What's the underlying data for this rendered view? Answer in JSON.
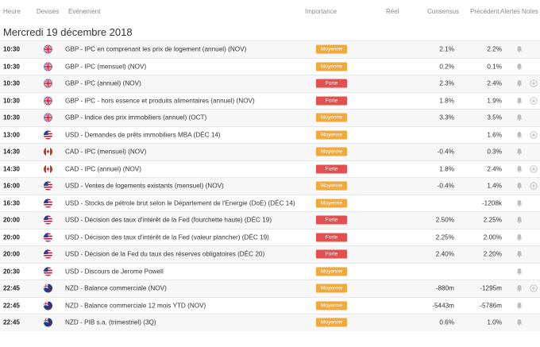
{
  "header": {
    "heure": "Heure",
    "devises": "Devises",
    "evenement": "Evénement",
    "importance": "Importance",
    "reel": "Réel",
    "consensus": "Consensus",
    "precedent": "Précédent",
    "alertes": "Alertes",
    "notes": "Notes"
  },
  "date_title": "Mercredi 19 décembre 2018",
  "colors": {
    "moyenne": "#f0a93b",
    "forte": "#e3504f"
  },
  "rows": [
    {
      "time": "10:30",
      "flag": "gb-flag-icon",
      "event": "GBP - IPC en comprenant les prix de logement (annuel) (NOV)",
      "importance": "Moyenne",
      "level": "moyenne",
      "consensus": "2.1%",
      "previous": "2.2%",
      "plus": false
    },
    {
      "time": "10:30",
      "flag": "gb-flag-icon",
      "event": "GBP - IPC (mensuel) (NOV)",
      "importance": "Moyenne",
      "level": "moyenne",
      "consensus": "0.2%",
      "previous": "0.1%",
      "plus": false
    },
    {
      "time": "10:30",
      "flag": "gb-flag-icon",
      "event": "GBP - IPC (annuel) (NOV)",
      "importance": "Forte",
      "level": "forte",
      "consensus": "2.3%",
      "previous": "2.4%",
      "plus": true
    },
    {
      "time": "10:30",
      "flag": "gb-flag-icon",
      "event": "GBP - IPC - hors essence et produits alimentaires (annuel) (NOV)",
      "importance": "Forte",
      "level": "forte",
      "consensus": "1.8%",
      "previous": "1.9%",
      "plus": true
    },
    {
      "time": "10:30",
      "flag": "gb-flag-icon",
      "event": "GBP - Indice des prix immobiliers (annuel) (OCT)",
      "importance": "Moyenne",
      "level": "moyenne",
      "consensus": "3.3%",
      "previous": "3.5%",
      "plus": false
    },
    {
      "time": "13:00",
      "flag": "us-flag-icon",
      "event": "USD - Demandes de prêts immobiliers MBA (DÉC 14)",
      "importance": "Moyenne",
      "level": "moyenne",
      "consensus": "",
      "previous": "1.6%",
      "plus": true
    },
    {
      "time": "14:30",
      "flag": "ca-flag-icon",
      "event": "CAD - IPC (mensuel) (NOV)",
      "importance": "Moyenne",
      "level": "moyenne",
      "consensus": "-0.4%",
      "previous": "0.3%",
      "plus": false
    },
    {
      "time": "14:30",
      "flag": "ca-flag-icon",
      "event": "CAD - IPC (annuel) (NOV)",
      "importance": "Forte",
      "level": "forte",
      "consensus": "1.8%",
      "previous": "2.4%",
      "plus": true
    },
    {
      "time": "16:00",
      "flag": "us-flag-icon",
      "event": "USD - Ventes de logements existants (mensuel) (NOV)",
      "importance": "Moyenne",
      "level": "moyenne",
      "consensus": "-0.4%",
      "previous": "1.4%",
      "plus": true
    },
    {
      "time": "16:30",
      "flag": "us-flag-icon",
      "event": "USD - Stocks de pétrole brut selon le Département de l'Energie (DoE) (DÉC 14)",
      "importance": "Moyenne",
      "level": "moyenne",
      "consensus": "",
      "previous": "-1208k",
      "plus": false
    },
    {
      "time": "20:00",
      "flag": "us-flag-icon",
      "event": "USD - Décision des taux d'intérêt de la Fed (fourchette haute) (DÉC 19)",
      "importance": "Forte",
      "level": "forte",
      "consensus": "2.50%",
      "previous": "2.25%",
      "plus": false
    },
    {
      "time": "20:00",
      "flag": "us-flag-icon",
      "event": "USD - Décision des taux d'intérêt de la Fed (valeur plancher) (DÉC 19)",
      "importance": "Forte",
      "level": "forte",
      "consensus": "2.25%",
      "previous": "2.00%",
      "plus": false
    },
    {
      "time": "20:00",
      "flag": "us-flag-icon",
      "event": "USD - Décision de la Fed du taux des réserves obligatoires (DÉC 20)",
      "importance": "Forte",
      "level": "forte",
      "consensus": "2.40%",
      "previous": "2.20%",
      "plus": false
    },
    {
      "time": "20:30",
      "flag": "us-flag-icon",
      "event": "USD - Discours de Jerome Powell",
      "importance": "Moyenne",
      "level": "moyenne",
      "consensus": "",
      "previous": "",
      "plus": false
    },
    {
      "time": "22:45",
      "flag": "nz-flag-icon",
      "event": "NZD - Balance commerciale (NOV)",
      "importance": "Moyenne",
      "level": "moyenne",
      "consensus": "-880m",
      "previous": "-1295m",
      "plus": true
    },
    {
      "time": "22:45",
      "flag": "nz-flag-icon",
      "event": "NZD - Balance commerciale 12 mois YTD (NOV)",
      "importance": "Moyenne",
      "level": "moyenne",
      "consensus": "-5443m",
      "previous": "-5786m",
      "plus": false
    },
    {
      "time": "22:45",
      "flag": "nz-flag-icon",
      "event": "NZD - PIB s.a. (trimestriel) (3Q)",
      "importance": "Moyenne",
      "level": "moyenne",
      "consensus": "0.6%",
      "previous": "1.0%",
      "plus": false
    }
  ]
}
